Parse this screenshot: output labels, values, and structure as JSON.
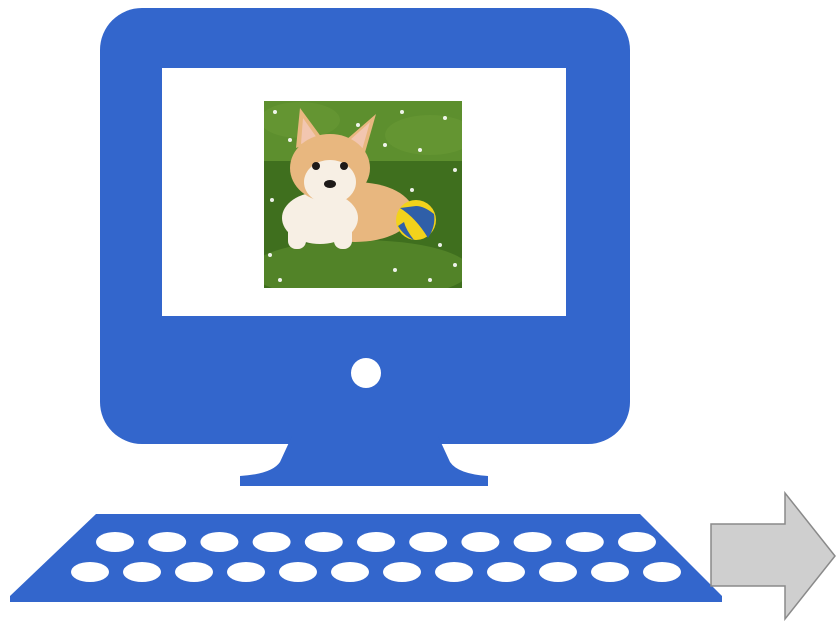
{
  "diagram": {
    "colors": {
      "device": "#3366cc",
      "screen": "#ffffff",
      "keys": "#ffffff",
      "arrow_fill": "#cfcfcf",
      "arrow_stroke": "#8a8a8a",
      "grass_dark": "#3f6f1e",
      "grass_light": "#6b9c35",
      "fur": "#e8b77f",
      "fur_light": "#f7efe4",
      "ball_yellow": "#f2d21b",
      "ball_blue": "#2f5fa8"
    },
    "monitor": {
      "icon": "desktop-monitor-icon",
      "screen_image": "puppy-with-ball-photo",
      "power_button": "power-button-icon"
    },
    "keyboard": {
      "icon": "keyboard-icon",
      "key_rows": [
        11,
        12
      ]
    },
    "arrow": {
      "icon": "right-arrow-icon",
      "direction": "right"
    }
  }
}
